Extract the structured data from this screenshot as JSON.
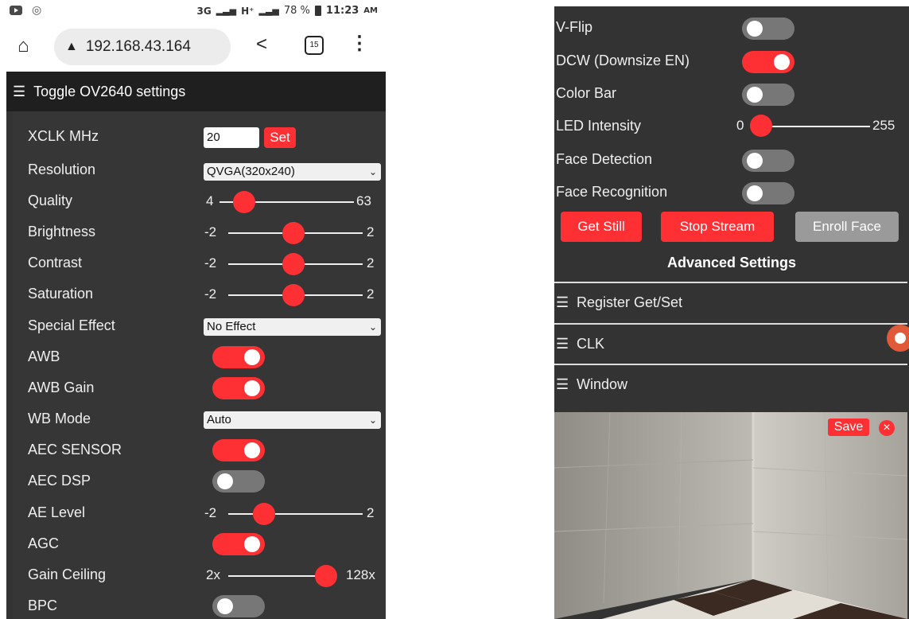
{
  "status_bar": {
    "network": "3G",
    "network2": "H⁺",
    "battery": "78 %",
    "time": "11:23",
    "ampm": "AM"
  },
  "browser": {
    "url": "192.168.43.164",
    "tab_count": "15"
  },
  "menu": {
    "title": "Toggle OV2640 settings"
  },
  "settings": {
    "xclk": {
      "label": "XCLK MHz",
      "value": "20",
      "button": "Set"
    },
    "resolution": {
      "label": "Resolution",
      "value": "QVGA(320x240)"
    },
    "quality": {
      "label": "Quality",
      "min": "4",
      "max": "63",
      "value": 10
    },
    "brightness": {
      "label": "Brightness",
      "min": "-2",
      "max": "2",
      "value": 0
    },
    "contrast": {
      "label": "Contrast",
      "min": "-2",
      "max": "2",
      "value": 0
    },
    "saturation": {
      "label": "Saturation",
      "min": "-2",
      "max": "2",
      "value": 0
    },
    "special_effect": {
      "label": "Special Effect",
      "value": "No Effect"
    },
    "awb": {
      "label": "AWB",
      "on": true
    },
    "awb_gain": {
      "label": "AWB Gain",
      "on": true
    },
    "wb_mode": {
      "label": "WB Mode",
      "value": "Auto"
    },
    "aec_sensor": {
      "label": "AEC SENSOR",
      "on": true
    },
    "aec_dsp": {
      "label": "AEC DSP",
      "on": false
    },
    "ae_level": {
      "label": "AE Level",
      "min": "-2",
      "max": "2",
      "value": -1
    },
    "agc": {
      "label": "AGC",
      "on": true
    },
    "gain_ceiling": {
      "label": "Gain Ceiling",
      "min": "2x",
      "max": "128x",
      "value": 1.0
    },
    "bpc": {
      "label": "BPC",
      "on": false
    }
  },
  "right": {
    "vflip": {
      "label": "V-Flip",
      "on": false
    },
    "dcw": {
      "label": "DCW (Downsize EN)",
      "on": true
    },
    "colorbar": {
      "label": "Color Bar",
      "on": false
    },
    "led": {
      "label": "LED Intensity",
      "min": "0",
      "max": "255",
      "value": 0
    },
    "face_detection": {
      "label": "Face Detection",
      "on": false
    },
    "face_recognition": {
      "label": "Face Recognition",
      "on": false
    },
    "buttons": {
      "get_still": "Get Still",
      "stop_stream": "Stop Stream",
      "enroll_face": "Enroll Face"
    },
    "advanced": "Advanced Settings",
    "sections": [
      "Register Get/Set",
      "CLK",
      "Window"
    ],
    "save": "Save",
    "close": "×"
  },
  "colors": {
    "accent": "#ff3034",
    "panel": "#333333",
    "header": "#1f1f1f"
  }
}
